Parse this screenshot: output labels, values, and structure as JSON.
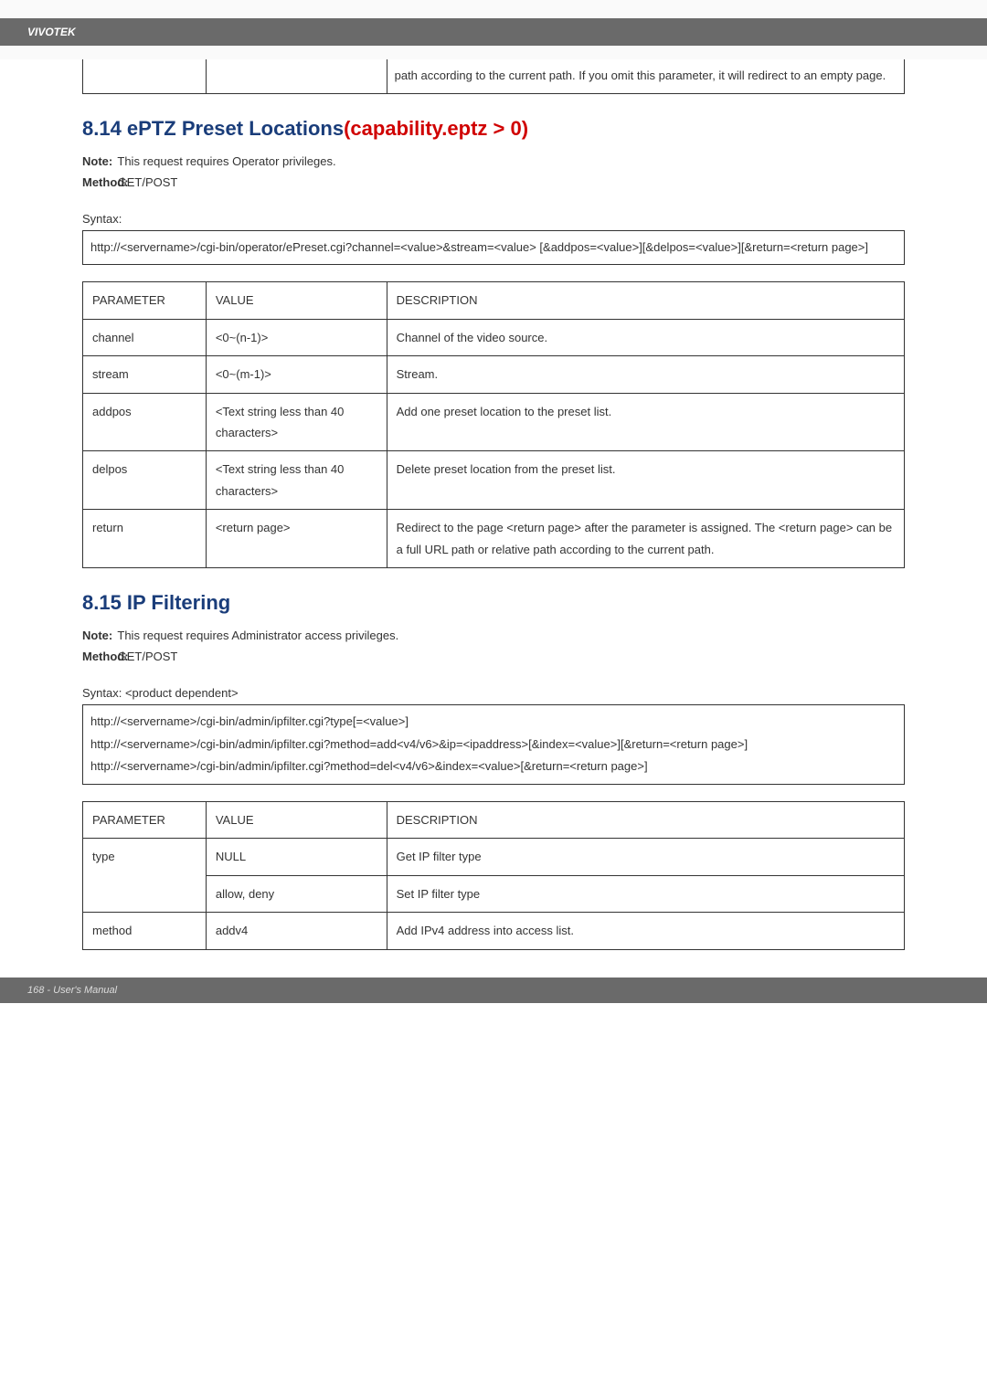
{
  "header": {
    "brand": "VIVOTEK"
  },
  "partial_row": {
    "desc": "path according to the current path. If you omit this parameter, it will redirect to an empty page."
  },
  "section_814": {
    "title_prefix": "8.14 ePTZ Preset Locations",
    "title_red": "(capability.eptz > 0)",
    "note": "This request requires Operator privileges.",
    "method_label": "Method:",
    "method": "GET/POST",
    "syntax_label": "Syntax:",
    "syntax_text": "http://<servername>/cgi-bin/operator/ePreset.cgi?channel=<value>&stream=<value> [&addpos=<value>][&delpos=<value>][&return=<return page>]",
    "table": {
      "headers": {
        "p": "PARAMETER",
        "v": "VALUE",
        "d": "DESCRIPTION"
      },
      "rows": [
        {
          "p": "channel",
          "v": "<0~(n-1)>",
          "d": "Channel of the video source."
        },
        {
          "p": "stream",
          "v": "<0~(m-1)>",
          "d": "Stream."
        },
        {
          "p": "addpos",
          "v": "<Text string less than 40 characters>",
          "d": "Add one preset location to the preset list."
        },
        {
          "p": "delpos",
          "v": "<Text string less than 40 characters>",
          "d": "Delete preset location from the preset list."
        },
        {
          "p": "return",
          "v": "<return page>",
          "d": "Redirect to the page <return page> after the parameter is assigned. The <return page> can be a full URL path or relative path according to the current path."
        }
      ]
    }
  },
  "section_815": {
    "title": "8.15 IP Filtering",
    "note": "This request requires Administrator access privileges.",
    "method_label": "Method:",
    "method": "GET/POST",
    "syntax_label": "Syntax: <product dependent>",
    "syntax_lines": {
      "l1": "http://<servername>/cgi-bin/admin/ipfilter.cgi?type[=<value>]",
      "l2": "http://<servername>/cgi-bin/admin/ipfilter.cgi?method=add<v4/v6>&ip=<ipaddress>[&index=<value>][&return=<return page>]",
      "l3": "http://<servername>/cgi-bin/admin/ipfilter.cgi?method=del<v4/v6>&index=<value>[&return=<return page>]"
    },
    "table": {
      "headers": {
        "p": "PARAMETER",
        "v": "VALUE",
        "d": "DESCRIPTION"
      },
      "rows": [
        {
          "p": "type",
          "v": "NULL",
          "d": "Get IP filter type"
        },
        {
          "p": "",
          "v": "allow, deny",
          "d": "Set IP filter type"
        },
        {
          "p": "method",
          "v": "addv4",
          "d": "Add IPv4 address into access list."
        }
      ]
    }
  },
  "footer": {
    "page": "168 - User's Manual"
  }
}
